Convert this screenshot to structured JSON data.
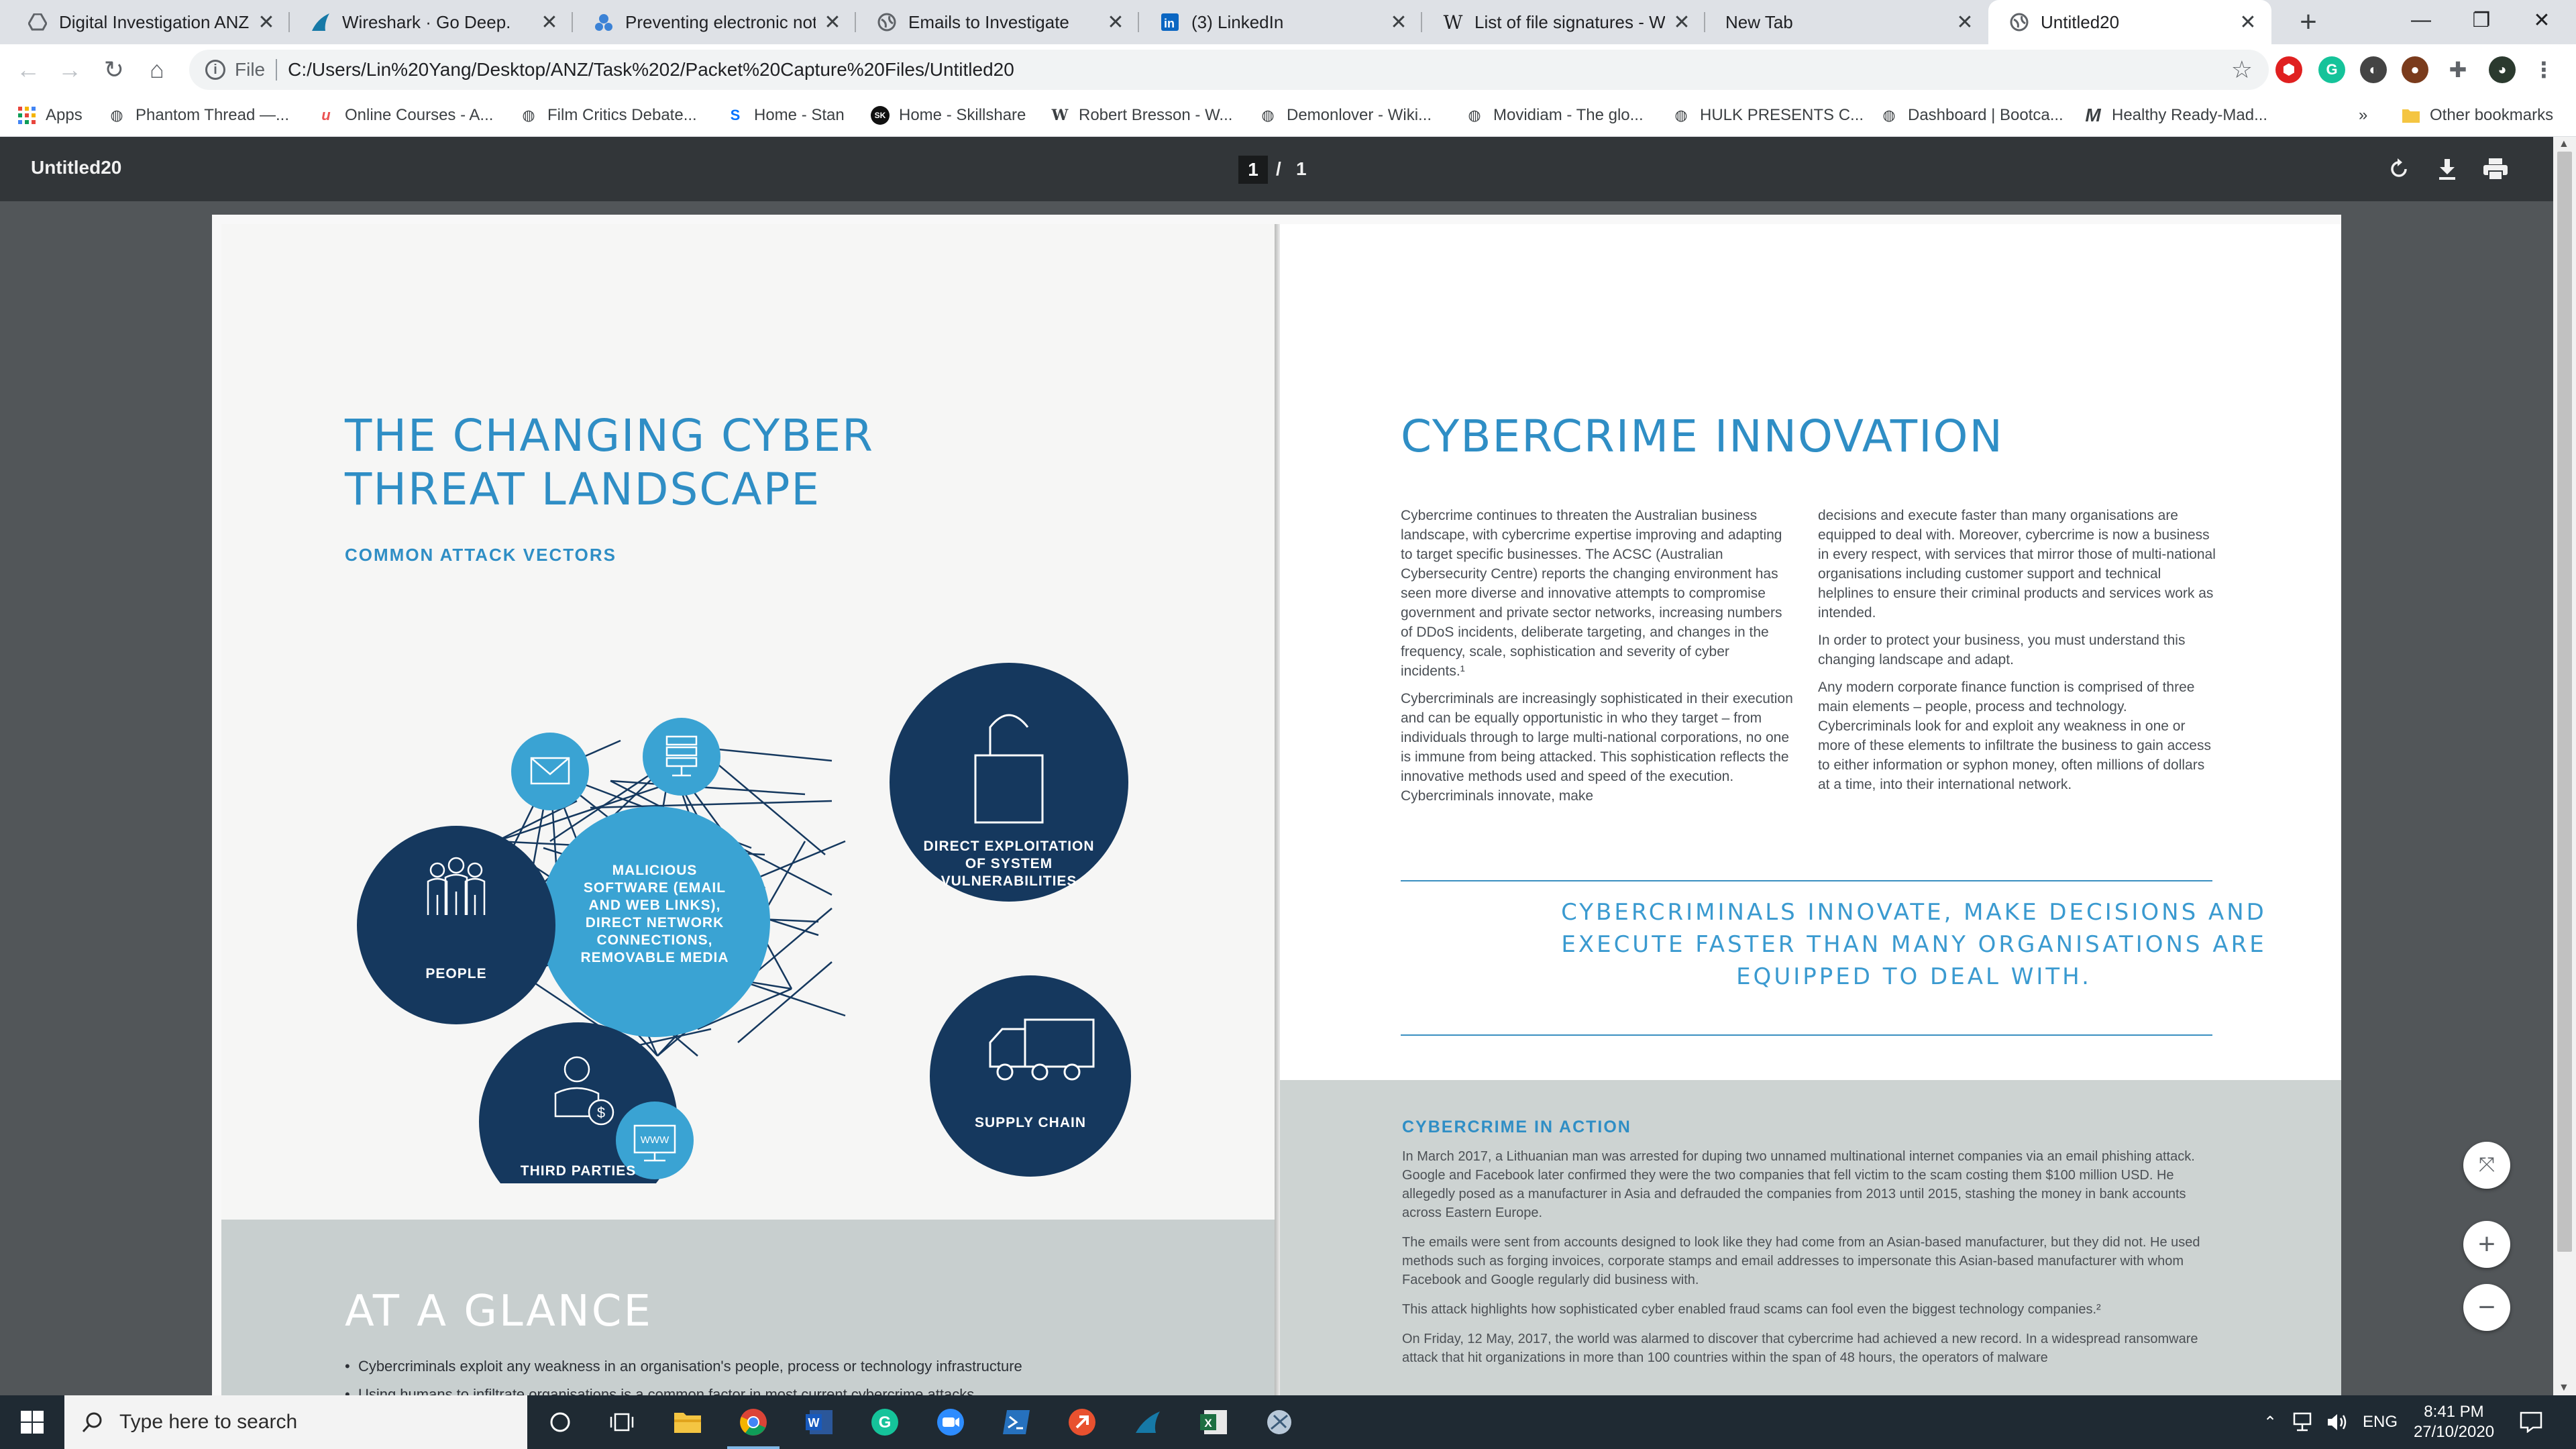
{
  "browser": {
    "tabs": [
      {
        "title": "Digital Investigation ANZ - ",
        "icon": "drive-icon",
        "color": "#5f6368"
      },
      {
        "title": "Wireshark · Go Deep.",
        "icon": "wireshark-fin-icon",
        "color": "#1679a7"
      },
      {
        "title": "Preventing electronic notific",
        "icon": "support-icon",
        "color": "#3b82d6"
      },
      {
        "title": "Emails to Investigate",
        "icon": "globe-icon",
        "color": "#5f6368"
      },
      {
        "title": "(3) LinkedIn",
        "icon": "linkedin-icon",
        "color": "#0a66c2"
      },
      {
        "title": "List of file signatures - Wiki",
        "icon": "wikipedia-icon",
        "color": "#202124"
      },
      {
        "title": "New Tab",
        "icon": "",
        "color": "#5f6368"
      },
      {
        "title": "Untitled20",
        "icon": "globe-icon",
        "color": "#5f6368"
      }
    ],
    "address": {
      "scheme": "File",
      "url": "C:/Users/Lin%20Yang/Desktop/ANZ/Task%202/Packet%20Capture%20Files/Untitled20"
    },
    "bookmarks": [
      {
        "label": "Apps",
        "icon": "apps-grid-icon"
      },
      {
        "label": "Phantom Thread —...",
        "icon": "globe-icon"
      },
      {
        "label": "Online Courses - A...",
        "icon": "udemy-icon"
      },
      {
        "label": "Film Critics Debate...",
        "icon": "globe-icon"
      },
      {
        "label": "Home - Stan",
        "icon": "stan-icon"
      },
      {
        "label": "Home - Skillshare",
        "icon": "skillshare-icon"
      },
      {
        "label": "Robert Bresson - W...",
        "icon": "wikipedia-icon"
      },
      {
        "label": "Demonlover - Wiki...",
        "icon": "globe-icon"
      },
      {
        "label": "Movidiam - The glo...",
        "icon": "globe-icon"
      },
      {
        "label": "HULK PRESENTS C...",
        "icon": "globe-icon"
      },
      {
        "label": "Dashboard | Bootca...",
        "icon": "globe-icon"
      },
      {
        "label": "Healthy Ready-Mad...",
        "icon": "m-logo-icon"
      }
    ],
    "bookmarks_more": "»",
    "other_bookmarks": "Other bookmarks"
  },
  "pdf": {
    "title": "Untitled20",
    "page_current": "1",
    "page_separator": "/",
    "page_total": "1"
  },
  "document": {
    "left_heading_line1": "THE CHANGING CYBER",
    "left_heading_line2": "THREAT LANDSCAPE",
    "common_attack_vectors": "COMMON ATTACK VECTORS",
    "diagram": {
      "people": "PEOPLE",
      "third_parties": "THIRD PARTIES",
      "malicious_l1": "MALICIOUS",
      "malicious_l2": "SOFTWARE (EMAIL",
      "malicious_l3": "AND WEB LINKS),",
      "malicious_l4": "DIRECT NETWORK",
      "malicious_l5": "CONNECTIONS,",
      "malicious_l6": "REMOVABLE MEDIA",
      "direct_l1": "DIRECT EXPLOITATION",
      "direct_l2": "OF SYSTEM",
      "direct_l3": "VULNERABILITIES",
      "supply_chain": "SUPPLY CHAIN",
      "www": "WWW"
    },
    "at_a_glance": "AT A GLANCE",
    "glance_items": [
      "Cybercriminals exploit any weakness in an organisation's people, process or technology infrastructure",
      "Using humans to infiltrate organisations is a common factor in most current cybercrime attacks"
    ],
    "right_heading": "CYBERCRIME INNOVATION",
    "col1_p1": "Cybercrime continues to threaten the Australian business landscape, with cybercrime expertise improving and adapting to target specific businesses. The ACSC (Australian Cybersecurity Centre) reports the changing environment has seen more diverse and innovative attempts to compromise government and private sector networks, increasing numbers of DDoS incidents, deliberate targeting, and changes in the frequency, scale, sophistication and severity of cyber incidents.¹",
    "col1_p2": "Cybercriminals are increasingly sophisticated in their execution and can be equally opportunistic in who they target – from individuals through to large multi-national corporations, no one is immune from being attacked. This sophistication reflects the innovative methods used and speed of the execution. Cybercriminals innovate, make",
    "col2_p1": "decisions and execute faster than many organisations are equipped to deal with. Moreover, cybercrime is now a business in every respect, with services that mirror those of multi-national organisations including customer support and technical helplines to ensure their criminal products and services work as intended.",
    "col2_p2": "In order to protect your business, you must understand this changing landscape and adapt.",
    "col2_p3": "Any modern corporate finance function is comprised of three main elements – people, process and technology. Cybercriminals look for and exploit any weakness in one or more of these elements to infiltrate the business to gain access to either information or syphon money, often millions of dollars at a time, into their international network.",
    "quote_l1": "CYBERCRIMINALS INNOVATE, MAKE DECISIONS AND",
    "quote_l2": "EXECUTE FASTER THAN MANY ORGANISATIONS ARE",
    "quote_l3": "EQUIPPED TO DEAL WITH.",
    "action_title": "CYBERCRIME IN ACTION",
    "action_p1": "In March 2017, a Lithuanian man was arrested for duping two unnamed multinational internet companies via an email phishing attack. Google and Facebook later confirmed they were the two companies that fell victim to the scam costing them $100 million USD. He allegedly posed as a manufacturer in Asia and defrauded the companies from 2013 until 2015, stashing the money in bank accounts across Eastern Europe.",
    "action_p2": "The emails were sent from accounts designed to look like they had come from an Asian-based manufacturer, but they did not. He used methods such as forging invoices, corporate stamps and email addresses to impersonate this Asian-based manufacturer with whom Facebook and Google regularly did business with.",
    "action_p3": "This attack highlights how sophisticated cyber enabled fraud scams can fool even the biggest technology companies.²",
    "action_p4": "On Friday, 12 May, 2017, the world was alarmed to discover that cybercrime had achieved a new record. In a widespread ransomware attack that hit organizations in more than 100 countries within the span of 48 hours, the operators of malware"
  },
  "taskbar": {
    "search_placeholder": "Type here to search",
    "language": "ENG",
    "time": "8:41 PM",
    "date": "27/10/2020"
  },
  "colors": {
    "accent_blue": "#2f8ec5",
    "navy": "#15385e",
    "light_blue": "#3aa3d3"
  }
}
